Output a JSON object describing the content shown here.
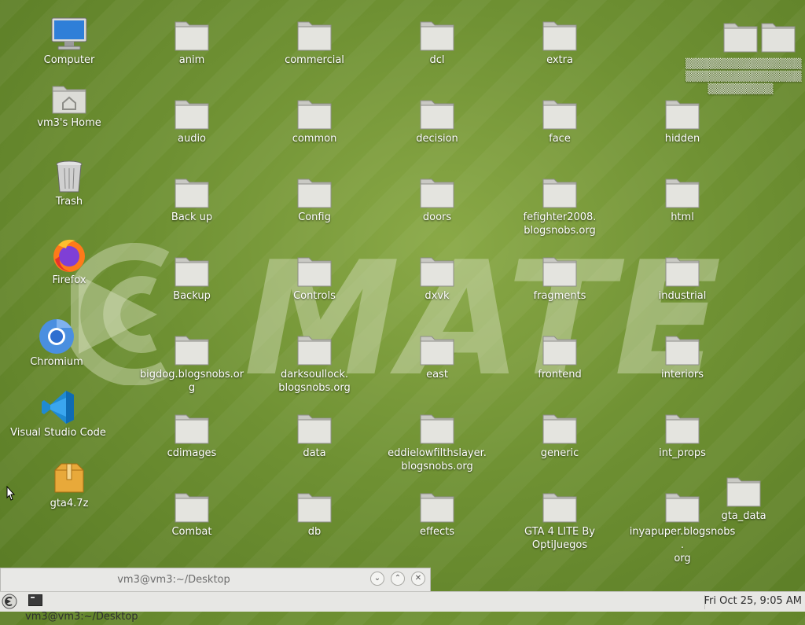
{
  "watermark": "MATE",
  "left_icons": [
    {
      "label": "Computer",
      "icon": "computer-icon"
    },
    {
      "label": "vm3's Home",
      "icon": "home-folder-icon"
    },
    {
      "label": "Trash",
      "icon": "trash-icon"
    },
    {
      "label": "Firefox",
      "icon": "firefox-icon"
    },
    {
      "label": "Chromium",
      "icon": "chromium-icon"
    },
    {
      "label": "Visual Studio Code",
      "icon": "vscode-icon"
    },
    {
      "label": "gta4.7z",
      "icon": "archive-icon"
    }
  ],
  "folders": {
    "col1": [
      "anim",
      "audio",
      "Back up",
      "Backup",
      "bigdog.blogsnobs.org",
      "cdimages",
      "Combat"
    ],
    "col2": [
      "commercial",
      "common",
      "Config",
      "Controls",
      "darksoullock.\nblogsnobs.org",
      "data",
      "db"
    ],
    "col3": [
      "dcl",
      "decision",
      "doors",
      "dxvk",
      "east",
      "eddielowfilthslayer.\nblogsnobs.org",
      "effects"
    ],
    "col4": [
      "extra",
      "face",
      "fefighter2008.\nblogsnobs.org",
      "fragments",
      "frontend",
      "generic",
      "GTA 4 LITE By\nOptiJuegos"
    ],
    "col5": [
      "hidden",
      "html",
      "industrial",
      "interiors",
      "int_props",
      "inyapuper.blogsnobs.\norg"
    ],
    "extra": "gta_data"
  },
  "window_strip": {
    "title": "vm3@vm3:~/Desktop"
  },
  "panel": {
    "task": "vm3@vm3:~/Desktop",
    "clock": "Fri Oct 25,  9:05 AM"
  }
}
